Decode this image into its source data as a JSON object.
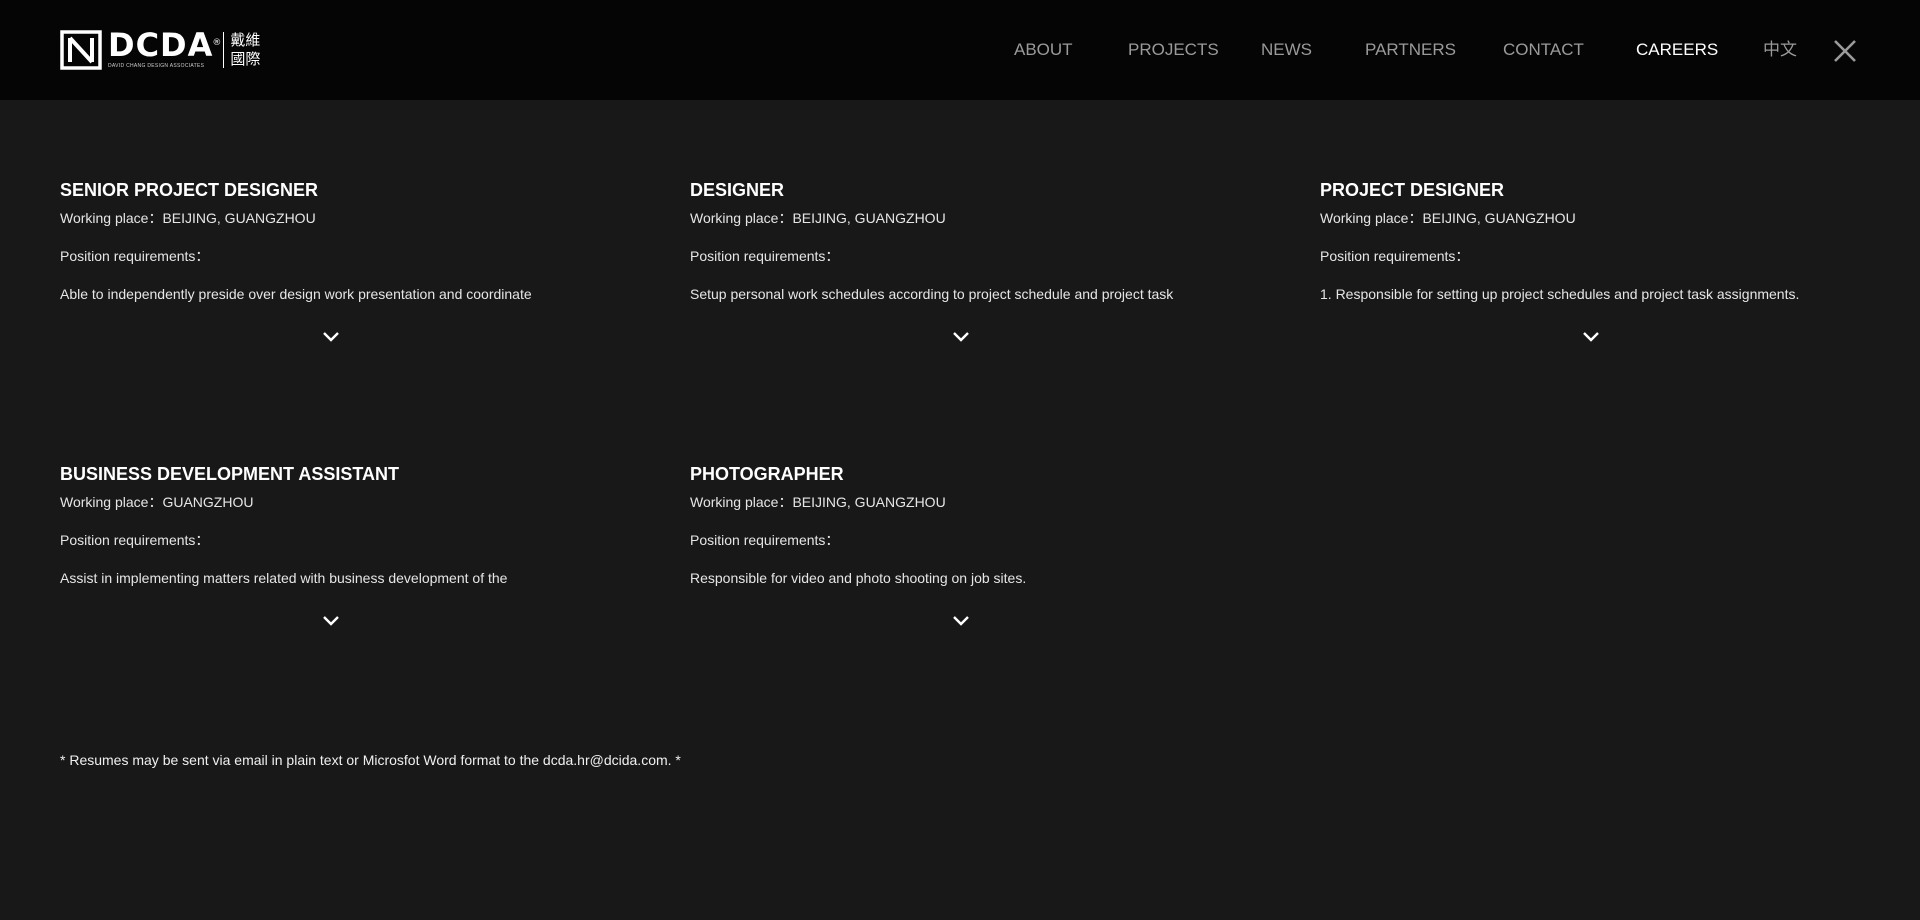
{
  "header": {
    "logo": {
      "wordmark": "DCDA",
      "registered": "®",
      "subtitle": "DAVID CHANG DESIGN ASSOCIATES",
      "cn_line1": "戴維",
      "cn_line2": "國際"
    },
    "nav": [
      {
        "label": "ABOUT",
        "active": false
      },
      {
        "label": "PROJECTS",
        "active": false
      },
      {
        "label": "NEWS",
        "active": false
      },
      {
        "label": "PARTNERS",
        "active": false
      },
      {
        "label": "CONTACT",
        "active": false
      },
      {
        "label": "CAREERS",
        "active": true
      },
      {
        "label": "中文",
        "active": false
      }
    ],
    "close_icon": "close-icon"
  },
  "jobs": [
    {
      "title": "SENIOR PROJECT DESIGNER",
      "place": "Working place：BEIJING, GUANGZHOU",
      "req_label": "Position requirements：",
      "req_text": " Able to independently preside over design work presentation and coordinate",
      "expand_icon": "chevron-down-icon"
    },
    {
      "title": "DESIGNER",
      "place": "Working place：BEIJING, GUANGZHOU",
      "req_label": "Position requirements：",
      "req_text": "Setup personal work schedules according to project schedule and project task",
      "expand_icon": "chevron-down-icon"
    },
    {
      "title": "PROJECT DESIGNER",
      "place": "Working place：BEIJING, GUANGZHOU",
      "req_label": "Position requirements：",
      "req_text": "1. Responsible for setting up project schedules and project task assignments.",
      "expand_icon": "chevron-down-icon"
    },
    {
      "title": "BUSINESS DEVELOPMENT ASSISTANT",
      "place": "Working place：GUANGZHOU",
      "req_label": "Position requirements：",
      "req_text": "Assist in implementing matters related with business development of the",
      "expand_icon": "chevron-down-icon"
    },
    {
      "title": "PHOTOGRAPHER",
      "place": "Working place：BEIJING, GUANGZHOU",
      "req_label": "Position requirements：",
      "req_text": "Responsible for video and photo shooting on job sites.",
      "expand_icon": "chevron-down-icon"
    }
  ],
  "footer_note": "* Resumes may be sent via email in plain text or Microsfot Word format to the dcda.hr@dcida.com. *",
  "colors": {
    "background": "#181818",
    "header_background": "#050505",
    "nav_text": "#9a9a9a",
    "nav_active": "#ffffff",
    "text": "#e6e6e6"
  }
}
